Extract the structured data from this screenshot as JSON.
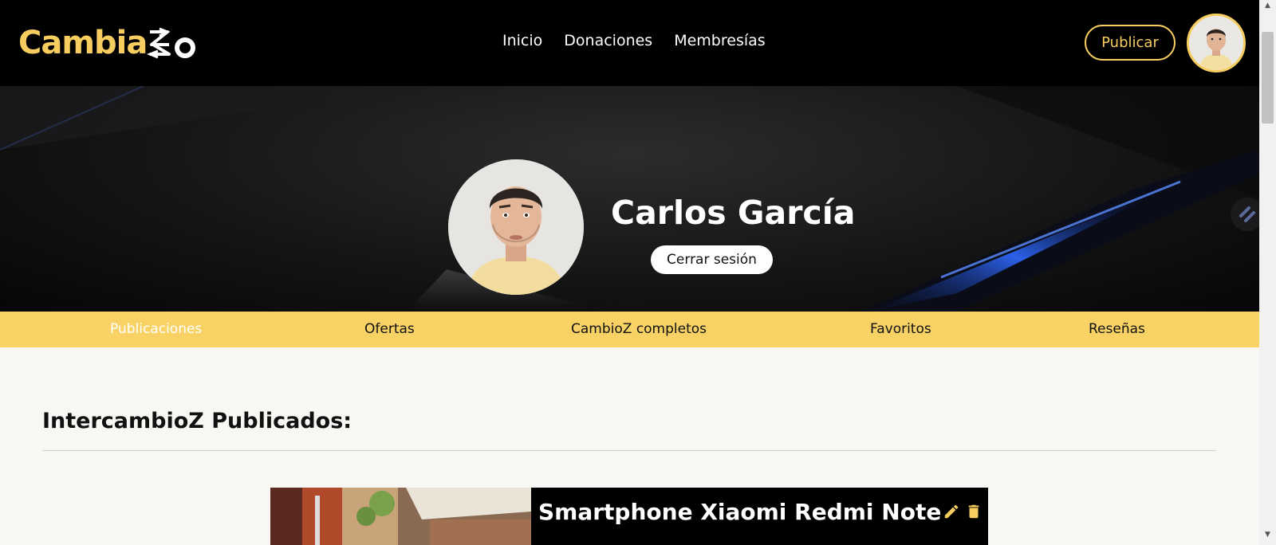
{
  "header": {
    "logo_text": "Cambia",
    "logo_color": "#f6cd5e",
    "nav": [
      {
        "label": "Inicio"
      },
      {
        "label": "Donaciones"
      },
      {
        "label": "Membresías"
      }
    ],
    "publish_label": "Publicar"
  },
  "profile": {
    "name": "Carlos García",
    "logout_label": "Cerrar sesión"
  },
  "tabs": [
    {
      "label": "Publicaciones",
      "active": true
    },
    {
      "label": "Ofertas",
      "active": false
    },
    {
      "label": "CambioZ completos",
      "active": false
    },
    {
      "label": "Favoritos",
      "active": false
    },
    {
      "label": "Reseñas",
      "active": false
    }
  ],
  "content": {
    "section_title": "IntercambioZ Publicados:",
    "cards": [
      {
        "title": "Smartphone Xiaomi Redmi Note"
      }
    ]
  },
  "icons": {
    "edit": "pencil-icon",
    "delete": "trash-icon",
    "floating": "swap-icon"
  },
  "colors": {
    "accent": "#f6cd5e",
    "tab_bar": "#f8d264",
    "background": "#f8f7f3"
  }
}
